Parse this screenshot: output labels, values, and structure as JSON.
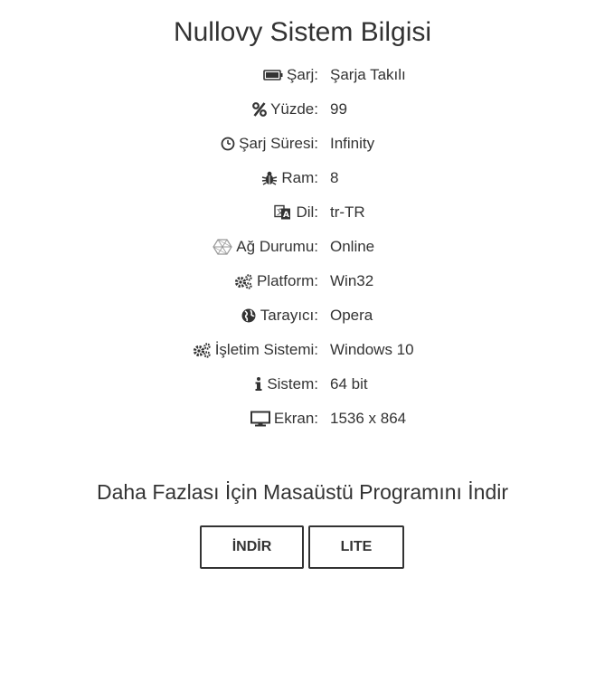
{
  "page": {
    "title": "Nullovy Sistem Bilgisi",
    "subtitle": "Daha Fazlası İçin Masaüstü Programını İndir"
  },
  "info_rows": [
    {
      "icon": "battery-icon",
      "label": "Şarj:",
      "value": "Şarja Takılı"
    },
    {
      "icon": "percent-icon",
      "label": "Yüzde:",
      "value": "99"
    },
    {
      "icon": "clock-icon",
      "label": "Şarj Süresi:",
      "value": "Infinity"
    },
    {
      "icon": "bug-icon",
      "label": "Ram:",
      "value": "8"
    },
    {
      "icon": "translate-icon",
      "label": "Dil:",
      "value": "tr-TR"
    },
    {
      "icon": "network-icon",
      "label": "Ağ Durumu:",
      "value": "Online"
    },
    {
      "icon": "gears-icon",
      "label": "Platform:",
      "value": "Win32"
    },
    {
      "icon": "globe-icon",
      "label": "Tarayıcı:",
      "value": "Opera"
    },
    {
      "icon": "gears-icon",
      "label": "İşletim Sistemi:",
      "value": "Windows 10"
    },
    {
      "icon": "info-icon",
      "label": "Sistem:",
      "value": "64 bit"
    },
    {
      "icon": "monitor-icon",
      "label": "Ekran:",
      "value": "1536 x 864"
    }
  ],
  "buttons": {
    "download_label": "İNDİR",
    "lite_label": "LITE"
  },
  "colors": {
    "text": "#333333",
    "background": "#ffffff",
    "button_border": "#333333"
  }
}
